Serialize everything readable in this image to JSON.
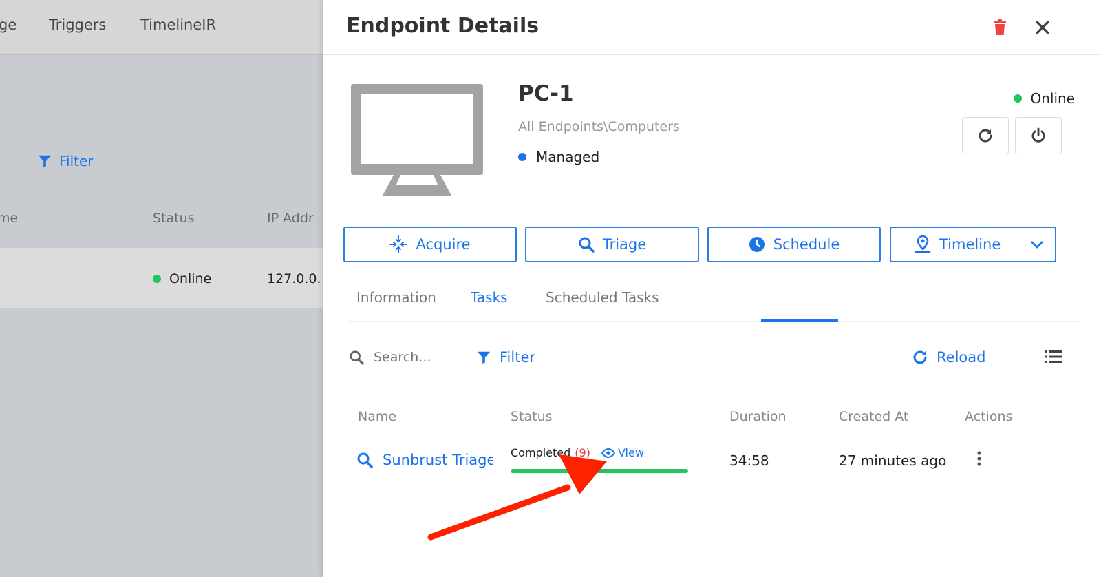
{
  "background": {
    "nav": [
      "ge",
      "Triggers",
      "TimelineIR"
    ],
    "filter_label": "Filter",
    "columns": [
      "me",
      "Status",
      "IP Addr"
    ],
    "row": {
      "status": "Online",
      "ip": "127.0.0."
    }
  },
  "panel": {
    "title": "Endpoint Details",
    "endpoint": {
      "name": "PC-1",
      "path": "All Endpoints\\Computers",
      "managed": "Managed",
      "online": "Online"
    },
    "actions": [
      "Acquire",
      "Triage",
      "Schedule",
      "Timeline"
    ],
    "tabs": [
      "Information",
      "Tasks",
      "Scheduled Tasks"
    ],
    "active_tab": "Tasks",
    "toolbar": {
      "search_placeholder": "Search...",
      "filter": "Filter",
      "reload": "Reload"
    },
    "table": {
      "columns": [
        "Name",
        "Status",
        "Duration",
        "Created At",
        "Actions"
      ],
      "rows": [
        {
          "name": "Sunbrust Triage",
          "status": "Completed",
          "count": "(9)",
          "view": "View",
          "progress": 1.0,
          "duration": "34:58",
          "created_at": "27 minutes ago"
        }
      ]
    }
  },
  "colors": {
    "accent": "#1a73e8",
    "online": "#22c55e",
    "managed": "#1a73e8",
    "delete": "#ef4444",
    "annotation_arrow": "#ff2200"
  }
}
